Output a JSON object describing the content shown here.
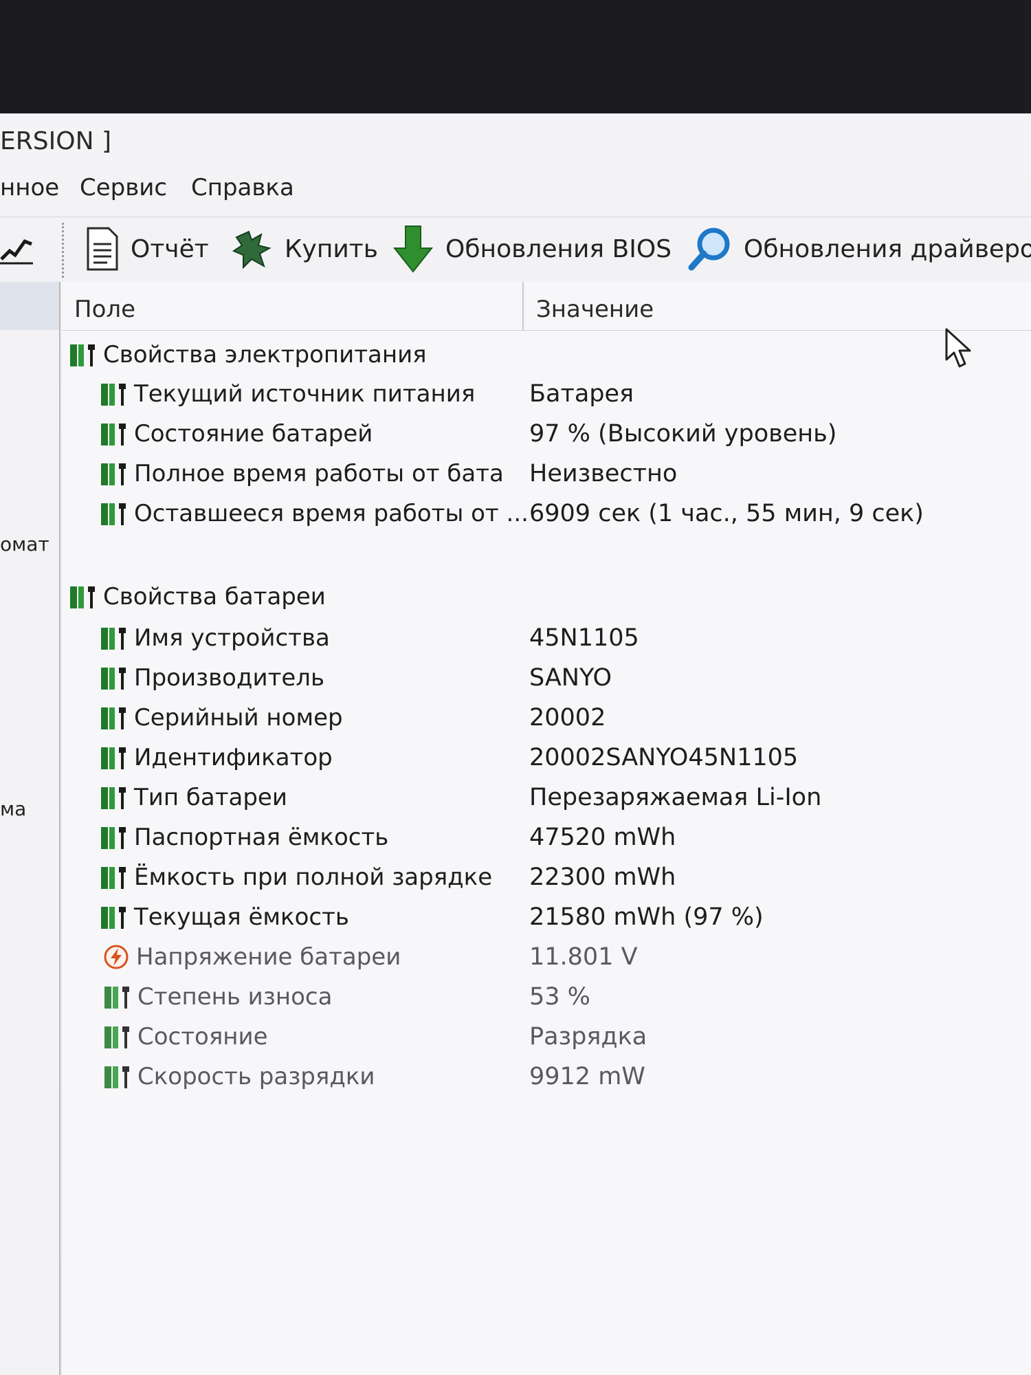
{
  "window": {
    "title": "ERSION ]"
  },
  "menu": [
    "нное",
    "Сервис",
    "Справка"
  ],
  "toolbar": {
    "report": "Отчёт",
    "buy": "Купить",
    "bios": "Обновления BIOS",
    "drivers": "Обновления драйверов"
  },
  "left_pane": [
    "омат",
    "ма"
  ],
  "columns": {
    "field": "Поле",
    "value": "Значение"
  },
  "groups": [
    {
      "title": "Свойства электропитания",
      "rows": [
        {
          "field": "Текущий источник питания",
          "value": "Батарея"
        },
        {
          "field": "Состояние батарей",
          "value": "97 % (Высокий уровень)"
        },
        {
          "field": "Полное время работы от бата",
          "value": "Неизвестно"
        },
        {
          "field": "Оставшееся время работы от ...",
          "value": "6909 сек (1 час., 55 мин, 9 сек)"
        }
      ]
    },
    {
      "title": "Свойства батареи",
      "rows": [
        {
          "field": "Имя устройства",
          "value": "45N1105"
        },
        {
          "field": "Производитель",
          "value": "SANYO"
        },
        {
          "field": "Серийный номер",
          "value": "20002"
        },
        {
          "field": "Идентификатор",
          "value": "20002SANYO45N1105"
        },
        {
          "field": "Тип батареи",
          "value": "Перезаряжаемая Li-Ion"
        },
        {
          "field": "Паспортная ёмкость",
          "value": "47520 mWh"
        },
        {
          "field": "Ёмкость при полной зарядке",
          "value": "22300 mWh"
        },
        {
          "field": "Текущая ёмкость",
          "value": "21580 mWh  (97 %)"
        },
        {
          "field": "Напряжение батареи",
          "value": "11.801 V",
          "icon": "voltage-icon"
        },
        {
          "field": "Степень износа",
          "value": "53 %"
        },
        {
          "field": "Состояние",
          "value": "Разрядка"
        },
        {
          "field": "Скорость разрядки",
          "value": "9912 mW"
        }
      ]
    }
  ],
  "colors": {
    "battery_green": "#1f7a2a",
    "voltage_orange": "#d9531e",
    "search_blue": "#1f78c8",
    "arrow_green": "#2f8f2f"
  }
}
